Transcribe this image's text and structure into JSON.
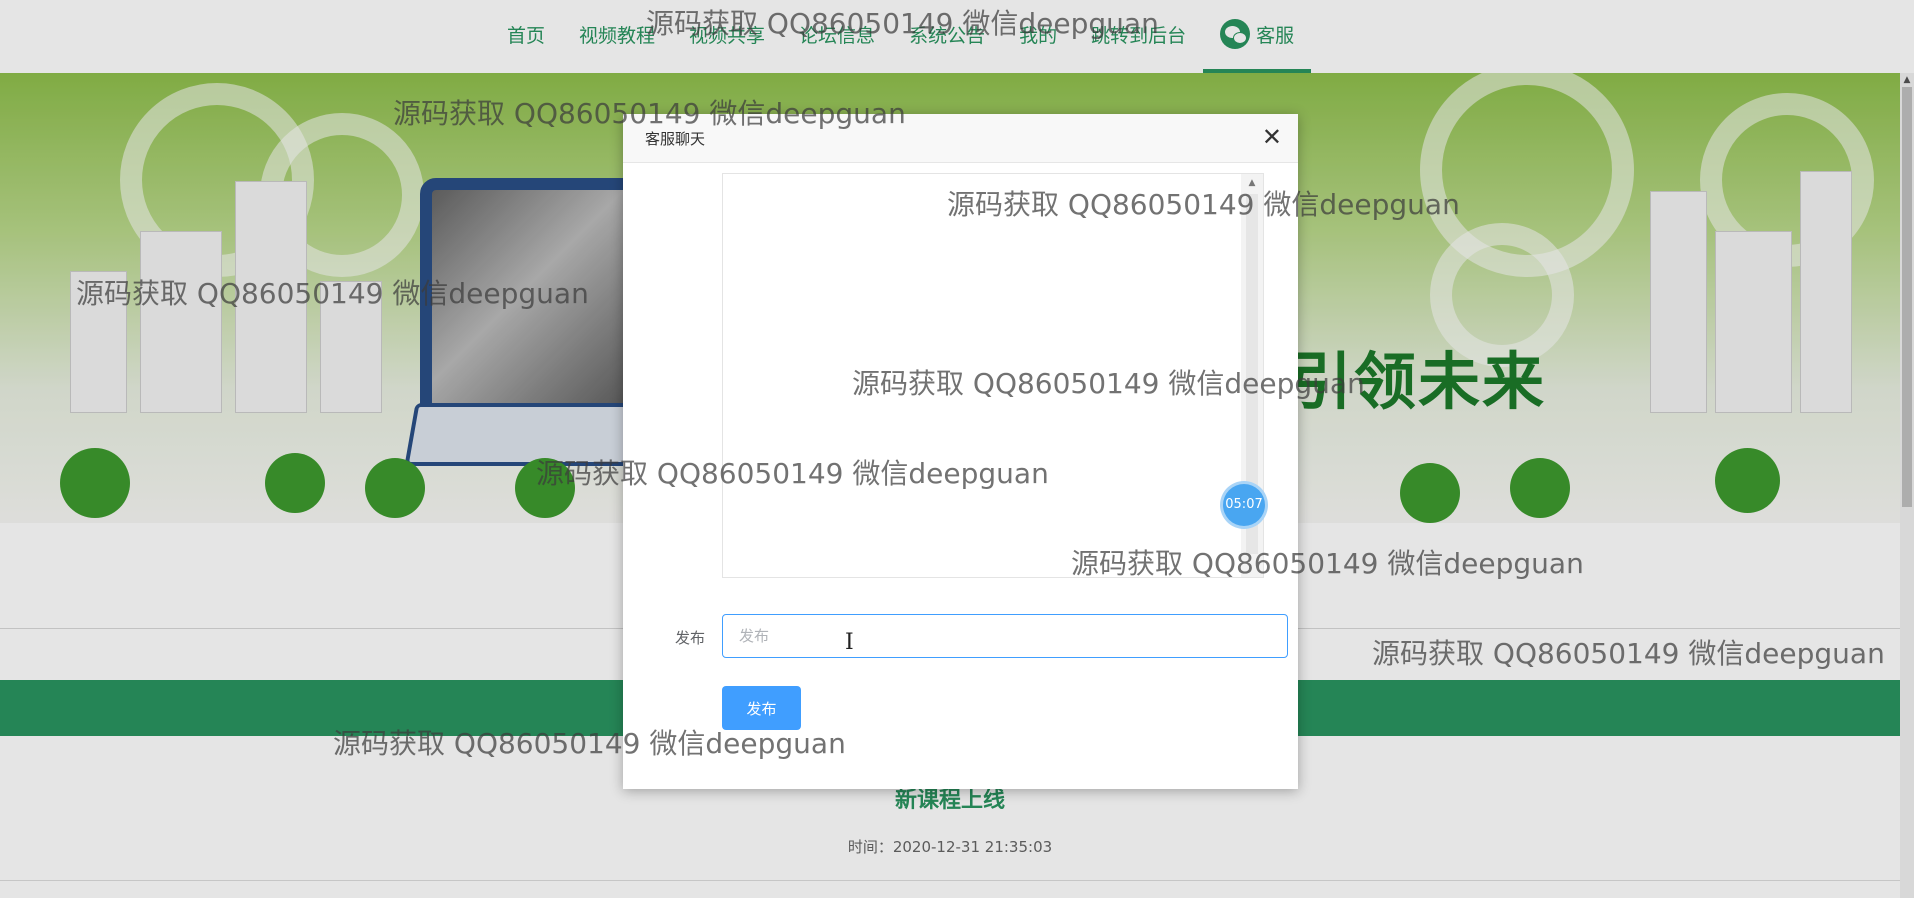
{
  "nav": {
    "items": [
      {
        "label": "首页"
      },
      {
        "label": "视频教程"
      },
      {
        "label": "视频共享"
      },
      {
        "label": "论坛信息"
      },
      {
        "label": "系统公告"
      },
      {
        "label": "我的"
      },
      {
        "label": "跳转到后台"
      },
      {
        "label": "客服",
        "icon": "wechat-icon",
        "active": true
      }
    ]
  },
  "banner": {
    "slogan": "引领未来"
  },
  "news": {
    "title": "新课程上线",
    "time": "时间：2020-12-31 21:35:03"
  },
  "dialog": {
    "title": "客服聊天",
    "close_icon": "close-icon",
    "time_badge": "05:07",
    "form_label": "发布",
    "input_placeholder": "发布",
    "submit_label": "发布"
  },
  "watermark_text": "源码获取 QQ86050149 微信deepguan",
  "colors": {
    "brand": "#2a9560",
    "primary": "#409eff"
  }
}
